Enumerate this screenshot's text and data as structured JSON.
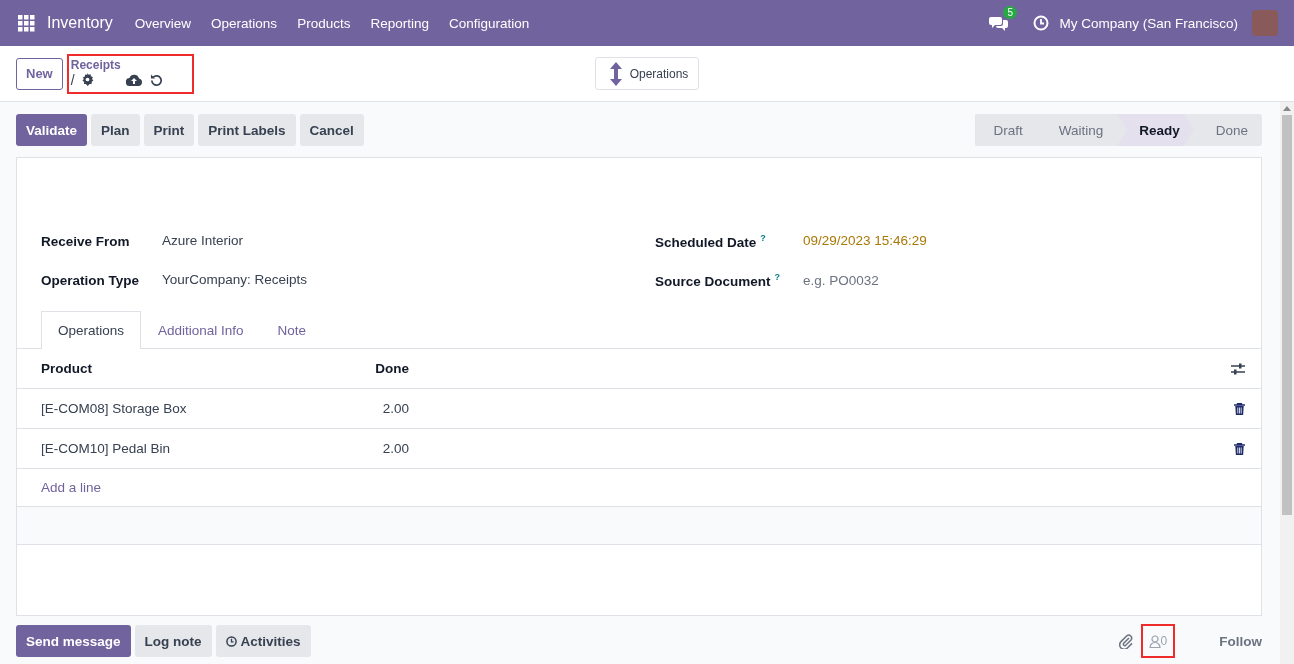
{
  "navbar": {
    "app": "Inventory",
    "menu": [
      "Overview",
      "Operations",
      "Products",
      "Reporting",
      "Configuration"
    ],
    "message_count": "5",
    "company": "My Company (San Francisco)"
  },
  "control_panel": {
    "new_button": "New",
    "breadcrumb": {
      "parent": "Receipts",
      "separator": "/",
      "highlighted": true
    },
    "switch_button": "Operations"
  },
  "actions": [
    {
      "label": "Validate",
      "primary": true
    },
    {
      "label": "Plan",
      "primary": false
    },
    {
      "label": "Print",
      "primary": false
    },
    {
      "label": "Print Labels",
      "primary": false
    },
    {
      "label": "Cancel",
      "primary": false
    }
  ],
  "statusbar": [
    {
      "label": "Draft",
      "selected": false
    },
    {
      "label": "Waiting",
      "selected": false
    },
    {
      "label": "Ready",
      "selected": true
    },
    {
      "label": "Done",
      "selected": false
    }
  ],
  "fields_left": [
    {
      "label": "Receive From",
      "value": "Azure Interior"
    },
    {
      "label": "Operation Type",
      "value": "YourCompany: Receipts"
    }
  ],
  "fields_right": [
    {
      "label": "Scheduled Date",
      "help": "?",
      "value": "09/29/2023 15:46:29",
      "kind": "date"
    },
    {
      "label": "Source Document",
      "help": "?",
      "placeholder": "e.g. PO0032",
      "kind": "input"
    }
  ],
  "tabs": [
    {
      "label": "Operations",
      "selected": true
    },
    {
      "label": "Additional Info",
      "selected": false
    },
    {
      "label": "Note",
      "selected": false
    }
  ],
  "table": {
    "columns": [
      "Product",
      "Done"
    ],
    "rows": [
      {
        "product": "[E-COM08] Storage Box",
        "done": "2.00"
      },
      {
        "product": "[E-COM10] Pedal Bin",
        "done": "2.00"
      }
    ],
    "add_line": "Add a line"
  },
  "chatter": {
    "buttons": [
      {
        "label": "Send message",
        "primary": true,
        "icon": false
      },
      {
        "label": "Log note",
        "primary": false,
        "icon": false
      },
      {
        "label": "Activities",
        "primary": false,
        "icon": true
      }
    ],
    "followers": "0",
    "followers_highlighted": true,
    "follow": "Follow"
  }
}
